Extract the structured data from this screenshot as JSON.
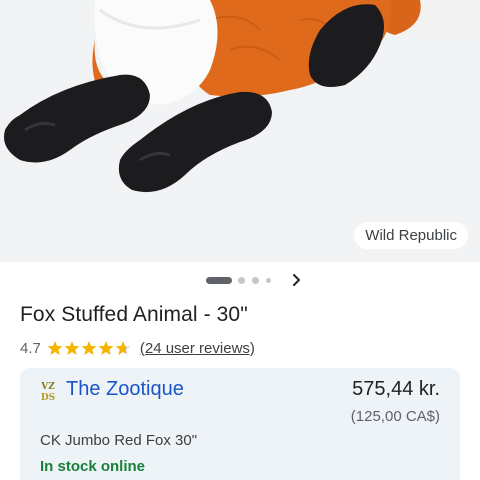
{
  "image": {
    "alt_icon": "fox-plush-photo",
    "brand_chip": "Wild Republic"
  },
  "carousel": {
    "dots": 4,
    "active_index": 0,
    "next_icon": "chevron-right-icon"
  },
  "product": {
    "title": "Fox Stuffed Animal - 30\"",
    "rating": "4.7",
    "stars_value": 4.7,
    "stars_max": 5,
    "reviews_label": "(24 user reviews)"
  },
  "offer": {
    "merchant_logo_text": "VZ DS",
    "merchant_name": "The Zootique",
    "price": "575,44 kr.",
    "original_price": "(125,00 CA$)",
    "product_name": "CK Jumbo Red Fox 30\"",
    "availability": "In stock online"
  },
  "colors": {
    "star": "#f4b400",
    "link": "#1a56c9",
    "stock": "#188038",
    "fox_orange": "#e06a1b",
    "fox_black": "#1c1c1e"
  }
}
